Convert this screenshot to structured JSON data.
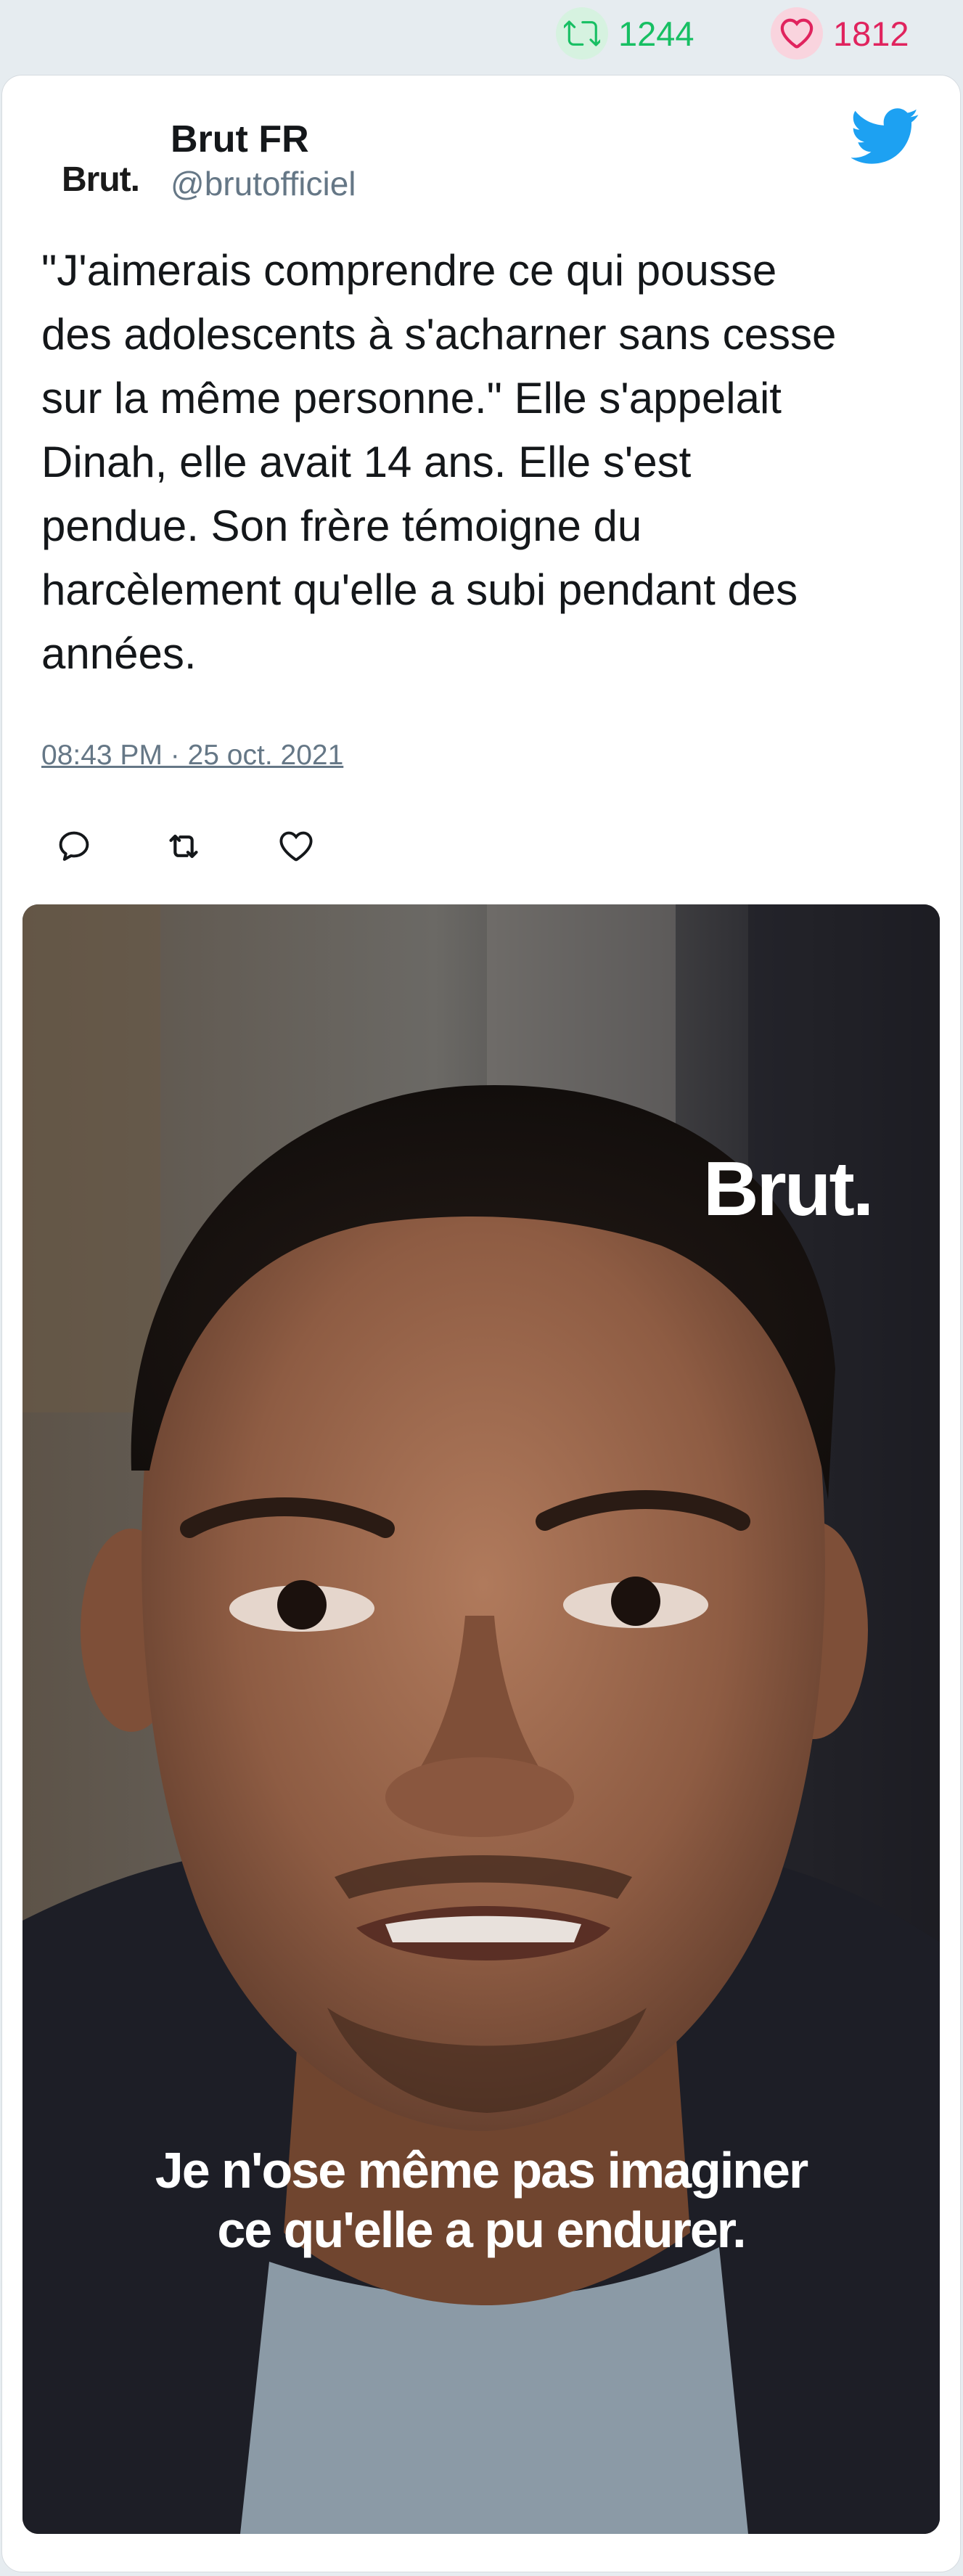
{
  "stats": {
    "retweets": "1244",
    "likes": "1812"
  },
  "author": {
    "avatar_text": "Brut.",
    "name": "Brut FR",
    "handle": "@brutofficiel"
  },
  "tweet": {
    "lines": [
      "\"J'aimerais comprendre ce qui pousse",
      "des adolescents à s'acharner sans cesse",
      "sur la même personne.\" Elle s'appelait",
      "Dinah, elle avait 14 ans. Elle s'est",
      "pendue. Son frère témoigne du",
      "harcèlement qu'elle a subi pendant des",
      "années."
    ],
    "date": "08:43 PM · 25 oct. 2021"
  },
  "icons": {
    "retweet": "retweet-icon",
    "like": "heart-icon",
    "reply": "reply-icon",
    "platform": "twitter-bird-icon"
  },
  "media": {
    "logo_text": "Brut.",
    "subtitle_lines": [
      "Je n'ose même pas imaginer",
      "ce qu'elle a pu endurer."
    ]
  },
  "colors": {
    "retweet_green": "#17bf63",
    "like_red": "#e0245e",
    "twitter_blue": "#1da1f2",
    "secondary_text": "#657786",
    "background": "#e6ecf0"
  }
}
